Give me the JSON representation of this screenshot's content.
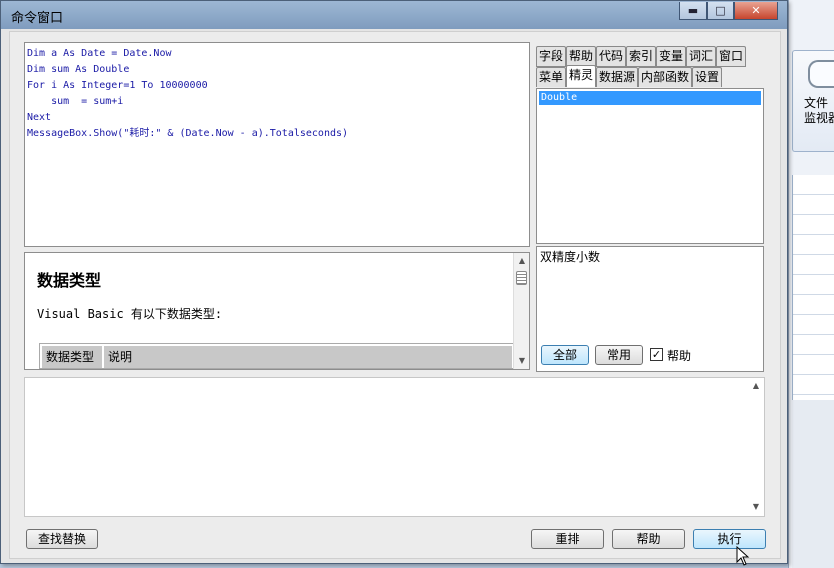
{
  "window": {
    "title": "命令窗口",
    "minimize_glyph": "▬",
    "maximize_glyph": "□",
    "close_glyph": "✕"
  },
  "background_app": {
    "ribbon_labels": [
      "文件",
      "监视器"
    ]
  },
  "editor": {
    "lines": [
      "Dim a As Date = Date.Now",
      "Dim sum As Double",
      "For i As Integer=1 To 10000000",
      "    sum  = sum+i",
      "Next",
      "MessageBox.Show(\"耗时:\" & (Date.Now - a).Totalseconds)"
    ]
  },
  "help": {
    "title": "数据类型",
    "body": "Visual Basic 有以下数据类型:",
    "table_headers": [
      "数据类型",
      "说明"
    ]
  },
  "tabs_row1": [
    "字段",
    "帮助",
    "代码",
    "索引",
    "变量",
    "词汇",
    "窗口"
  ],
  "tabs_row2": [
    "菜单",
    "精灵",
    "数据源",
    "内部函数",
    "设置"
  ],
  "active_tab": "精灵",
  "list": {
    "selected_item": "Double"
  },
  "description": "双精度小数",
  "filter_buttons": {
    "all": "全部",
    "common": "常用",
    "help_checkbox_label": "帮助",
    "help_checked": true
  },
  "bottom_buttons": {
    "find_replace": "查找替换",
    "rearrange": "重排",
    "help": "帮助",
    "execute": "执行"
  },
  "colors": {
    "code_text": "#1a1aa6",
    "selection": "#3399ff",
    "title_bar": "#8fa9c9"
  }
}
